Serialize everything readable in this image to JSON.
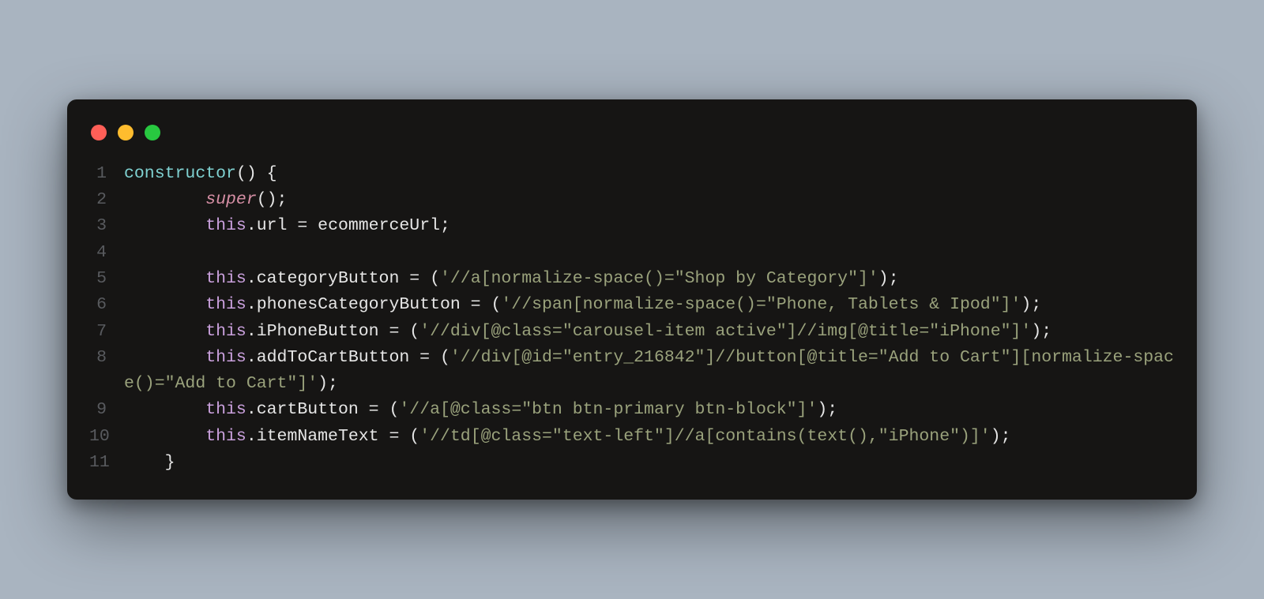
{
  "window": {
    "traffic_lights": [
      "red",
      "yellow",
      "green"
    ]
  },
  "code": {
    "lines": [
      {
        "n": "1",
        "indent": "",
        "segments": [
          {
            "cls": "tok-kw",
            "t": "constructor"
          },
          {
            "cls": "tok-punct",
            "t": "() {"
          }
        ]
      },
      {
        "n": "2",
        "indent": "        ",
        "segments": [
          {
            "cls": "tok-super",
            "t": "super"
          },
          {
            "cls": "tok-punct",
            "t": "();"
          }
        ]
      },
      {
        "n": "3",
        "indent": "        ",
        "segments": [
          {
            "cls": "tok-this",
            "t": "this"
          },
          {
            "cls": "tok-punct",
            "t": "."
          },
          {
            "cls": "tok-prop",
            "t": "url"
          },
          {
            "cls": "tok-op",
            "t": " = "
          },
          {
            "cls": "tok-ident",
            "t": "ecommerceUrl"
          },
          {
            "cls": "tok-punct",
            "t": ";"
          }
        ]
      },
      {
        "n": "4",
        "indent": "",
        "segments": []
      },
      {
        "n": "5",
        "indent": "        ",
        "segments": [
          {
            "cls": "tok-this",
            "t": "this"
          },
          {
            "cls": "tok-punct",
            "t": "."
          },
          {
            "cls": "tok-prop",
            "t": "categoryButton"
          },
          {
            "cls": "tok-op",
            "t": " = "
          },
          {
            "cls": "tok-punct",
            "t": "("
          },
          {
            "cls": "tok-str",
            "t": "'//a[normalize-space()=\"Shop by Category\"]'"
          },
          {
            "cls": "tok-punct",
            "t": ");"
          }
        ]
      },
      {
        "n": "6",
        "indent": "        ",
        "segments": [
          {
            "cls": "tok-this",
            "t": "this"
          },
          {
            "cls": "tok-punct",
            "t": "."
          },
          {
            "cls": "tok-prop",
            "t": "phonesCategoryButton"
          },
          {
            "cls": "tok-op",
            "t": " = "
          },
          {
            "cls": "tok-punct",
            "t": "("
          },
          {
            "cls": "tok-str",
            "t": "'//span[normalize-space()=\"Phone, Tablets & Ipod\"]'"
          },
          {
            "cls": "tok-punct",
            "t": ");"
          }
        ]
      },
      {
        "n": "7",
        "indent": "        ",
        "segments": [
          {
            "cls": "tok-this",
            "t": "this"
          },
          {
            "cls": "tok-punct",
            "t": "."
          },
          {
            "cls": "tok-prop",
            "t": "iPhoneButton"
          },
          {
            "cls": "tok-op",
            "t": " = "
          },
          {
            "cls": "tok-punct",
            "t": "("
          },
          {
            "cls": "tok-str",
            "t": "'//div[@class=\"carousel-item active\"]//img[@title=\"iPhone\"]'"
          },
          {
            "cls": "tok-punct",
            "t": ");"
          }
        ]
      },
      {
        "n": "8",
        "indent": "        ",
        "segments": [
          {
            "cls": "tok-this",
            "t": "this"
          },
          {
            "cls": "tok-punct",
            "t": "."
          },
          {
            "cls": "tok-prop",
            "t": "addToCartButton"
          },
          {
            "cls": "tok-op",
            "t": " = "
          },
          {
            "cls": "tok-punct",
            "t": "("
          },
          {
            "cls": "tok-str",
            "t": "'//div[@id=\"entry_216842\"]//button[@title=\"Add to Cart\"][normalize-space()=\"Add to Cart\"]'"
          },
          {
            "cls": "tok-punct",
            "t": ");"
          }
        ]
      },
      {
        "n": "9",
        "indent": "        ",
        "segments": [
          {
            "cls": "tok-this",
            "t": "this"
          },
          {
            "cls": "tok-punct",
            "t": "."
          },
          {
            "cls": "tok-prop",
            "t": "cartButton"
          },
          {
            "cls": "tok-op",
            "t": " = "
          },
          {
            "cls": "tok-punct",
            "t": "("
          },
          {
            "cls": "tok-str",
            "t": "'//a[@class=\"btn btn-primary btn-block\"]'"
          },
          {
            "cls": "tok-punct",
            "t": ");"
          }
        ]
      },
      {
        "n": "10",
        "indent": "        ",
        "segments": [
          {
            "cls": "tok-this",
            "t": "this"
          },
          {
            "cls": "tok-punct",
            "t": "."
          },
          {
            "cls": "tok-prop",
            "t": "itemNameText"
          },
          {
            "cls": "tok-op",
            "t": " = "
          },
          {
            "cls": "tok-punct",
            "t": "("
          },
          {
            "cls": "tok-str",
            "t": "'//td[@class=\"text-left\"]//a[contains(text(),\"iPhone\")]'"
          },
          {
            "cls": "tok-punct",
            "t": ");"
          }
        ]
      },
      {
        "n": "11",
        "indent": "    ",
        "segments": [
          {
            "cls": "tok-punct",
            "t": "}"
          }
        ]
      }
    ]
  }
}
